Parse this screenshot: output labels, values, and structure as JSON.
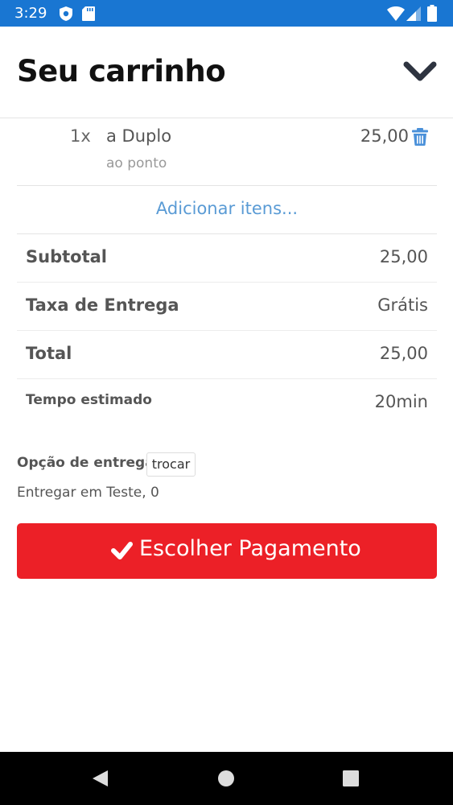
{
  "status_bar": {
    "time": "3:29"
  },
  "header": {
    "title": "Seu carrinho"
  },
  "cart": {
    "items": [
      {
        "quantity": "1x",
        "name": "a Duplo",
        "note": "ao ponto",
        "price": "25,00"
      }
    ],
    "add_items_label": "Adicionar itens..."
  },
  "summary": {
    "subtotal_label": "Subtotal",
    "subtotal_value": "25,00",
    "delivery_fee_label": "Taxa de Entrega",
    "delivery_fee_value": "Grátis",
    "total_label": "Total",
    "total_value": "25,00",
    "estimated_time_label": "Tempo estimado",
    "estimated_time_value": "20min"
  },
  "delivery": {
    "option_label": "Opção de entrega",
    "change_label": "trocar",
    "address": "Entregar em Teste, 0"
  },
  "payment_button": {
    "label": "Escolher Pagamento"
  },
  "colors": {
    "status_bar": "#1976d2",
    "accent_link": "#5a9bd5",
    "trash_icon": "#4a90d9",
    "payment_button": "#ec2027",
    "nav_bar": "#000000"
  },
  "icons": {
    "shield": "shield-icon",
    "sd_card": "sd-card-icon",
    "wifi": "wifi-icon",
    "signal": "signal-icon",
    "battery": "battery-icon",
    "collapse": "chevron-down-icon",
    "trash": "trash-icon",
    "check": "check-icon",
    "back": "back-icon",
    "home": "home-icon",
    "recent": "recent-apps-icon"
  }
}
